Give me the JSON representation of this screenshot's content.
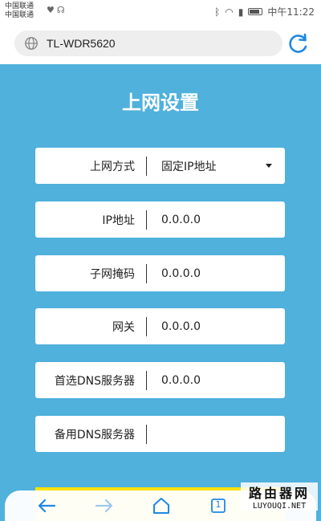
{
  "status_bar": {
    "carrier_1": "中国联通",
    "carrier_2": "中国联通",
    "time": "中午11:22"
  },
  "browser": {
    "url": "TL-WDR5620"
  },
  "page": {
    "title": "上网设置",
    "fields": [
      {
        "label": "上网方式",
        "value": "固定IP地址"
      },
      {
        "label": "IP地址",
        "value": "0.0.0.0"
      },
      {
        "label": "子网掩码",
        "value": "0.0.0.0"
      },
      {
        "label": "网关",
        "value": "0.0.0.0"
      },
      {
        "label": "首选DNS服务器",
        "value": "0.0.0.0"
      },
      {
        "label": "备用DNS服务器",
        "value": ""
      }
    ]
  },
  "bottom_nav": {
    "tab_count": "1"
  },
  "watermark": {
    "line1": "路由器网",
    "line2": "LUYOUQI.NET"
  },
  "colors": {
    "background": "#4fb1dc",
    "button": "#ffe200",
    "accent": "#1e88e5"
  }
}
